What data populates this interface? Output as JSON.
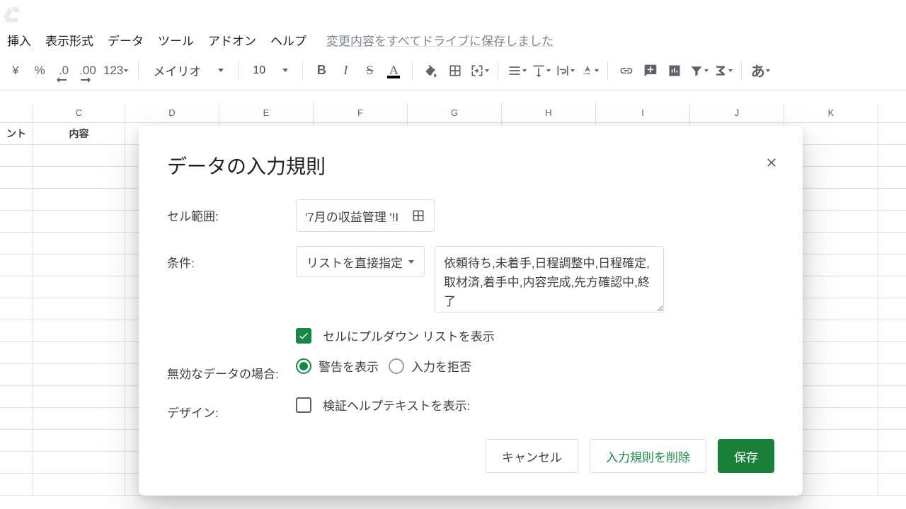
{
  "menubar": {
    "items": [
      "挿入",
      "表示形式",
      "データ",
      "ツール",
      "アドオン",
      "ヘルプ"
    ],
    "save_status": "変更内容をすべてドライブに保存しました"
  },
  "toolbar": {
    "currency": "¥",
    "percent": "%",
    "dec_dec": ".0",
    "inc_dec": ".00",
    "more_fmt": "123",
    "font": "メイリオ",
    "font_size": "10",
    "bold": "B",
    "italic": "I",
    "strike": "S",
    "text_color_letter": "A",
    "input_lang": "あ"
  },
  "grid": {
    "cols": [
      "C",
      "D",
      "E",
      "F",
      "G",
      "H",
      "I",
      "J",
      "K"
    ],
    "header_row": {
      "partial_label1": "ント",
      "col_c_label": "内容"
    }
  },
  "dialog": {
    "title": "データの入力規則",
    "labels": {
      "range": "セル範囲:",
      "condition": "条件:",
      "invalid": "無効なデータの場合:",
      "design": "デザイン:"
    },
    "range_value": "'7月の収益管理 '!I",
    "condition_type": "リストを直接指定",
    "list_items": "依頼待ち,未着手,日程調整中,日程確定,取材済,着手中,内容完成,先方確認中,終了",
    "show_dropdown_label": "セルにプルダウン リストを表示",
    "show_dropdown_checked": true,
    "invalid_options": {
      "warn": "警告を表示",
      "reject": "入力を拒否"
    },
    "invalid_selected": "warn",
    "help_text_label": "検証ヘルプテキストを表示:",
    "help_text_checked": false,
    "buttons": {
      "cancel": "キャンセル",
      "remove": "入力規則を削除",
      "save": "保存"
    }
  }
}
